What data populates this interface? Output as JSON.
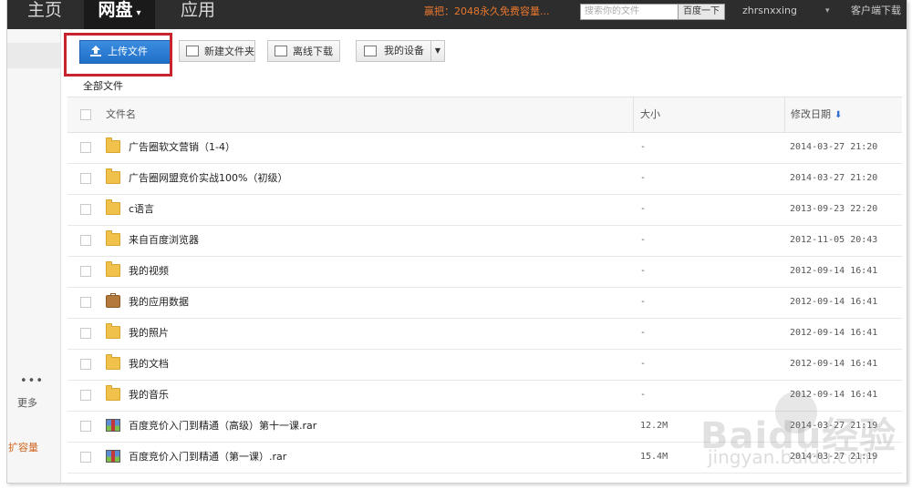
{
  "nav": {
    "home": "主页",
    "disk": "网盘",
    "app": "应用",
    "promo": "赢把：2048永久免费容量...",
    "search_placeholder": "搜索你的文件",
    "search_button": "百度一下",
    "user": "zhrsnxxing",
    "client": "客户端下载"
  },
  "sidebar": {
    "more": "更多",
    "expand": "扩容量"
  },
  "toolbar": {
    "upload": "上传文件",
    "new_folder": "新建文件夹",
    "offline_download": "离线下载",
    "my_devices": "我的设备"
  },
  "breadcrumb": "全部文件",
  "table": {
    "headers": {
      "name": "文件名",
      "size": "大小",
      "date": "修改日期"
    },
    "rows": [
      {
        "icon": "folder-icon",
        "name": "广告圈软文营销（1-4）",
        "size": "-",
        "date": "2014-03-27 21:20"
      },
      {
        "icon": "folder-icon",
        "name": "广告圈网盟竞价实战100%（初级）",
        "size": "-",
        "date": "2014-03-27 21:20"
      },
      {
        "icon": "folder-icon",
        "name": "c语言",
        "size": "-",
        "date": "2013-09-23 22:20"
      },
      {
        "icon": "folder-icon",
        "name": "来自百度浏览器",
        "size": "-",
        "date": "2012-11-05 20:43"
      },
      {
        "icon": "folder-icon",
        "name": "我的视频",
        "size": "-",
        "date": "2012-09-14 16:41"
      },
      {
        "icon": "app-data-icon",
        "name": "我的应用数据",
        "size": "-",
        "date": "2012-09-14 16:41"
      },
      {
        "icon": "folder-icon",
        "name": "我的照片",
        "size": "-",
        "date": "2012-09-14 16:41"
      },
      {
        "icon": "folder-icon",
        "name": "我的文档",
        "size": "-",
        "date": "2012-09-14 16:41"
      },
      {
        "icon": "folder-icon",
        "name": "我的音乐",
        "size": "-",
        "date": "2012-09-14 16:41"
      },
      {
        "icon": "rar-icon",
        "name": "百度竞价入门到精通（高级）第十一课.rar",
        "size": "12.2M",
        "date": "2014-03-27 21:19"
      },
      {
        "icon": "rar-icon",
        "name": "百度竞价入门到精通（第一课）.rar",
        "size": "15.4M",
        "date": "2014-03-27 21:19"
      }
    ]
  },
  "watermark": {
    "brand": "Baidu经验",
    "url": "jingyan.baidu.com"
  },
  "colors": {
    "highlight": "#c8242e",
    "upload_button": "#2a7bd6",
    "topbar": "#2d2d2d",
    "promo": "#e8772e"
  }
}
